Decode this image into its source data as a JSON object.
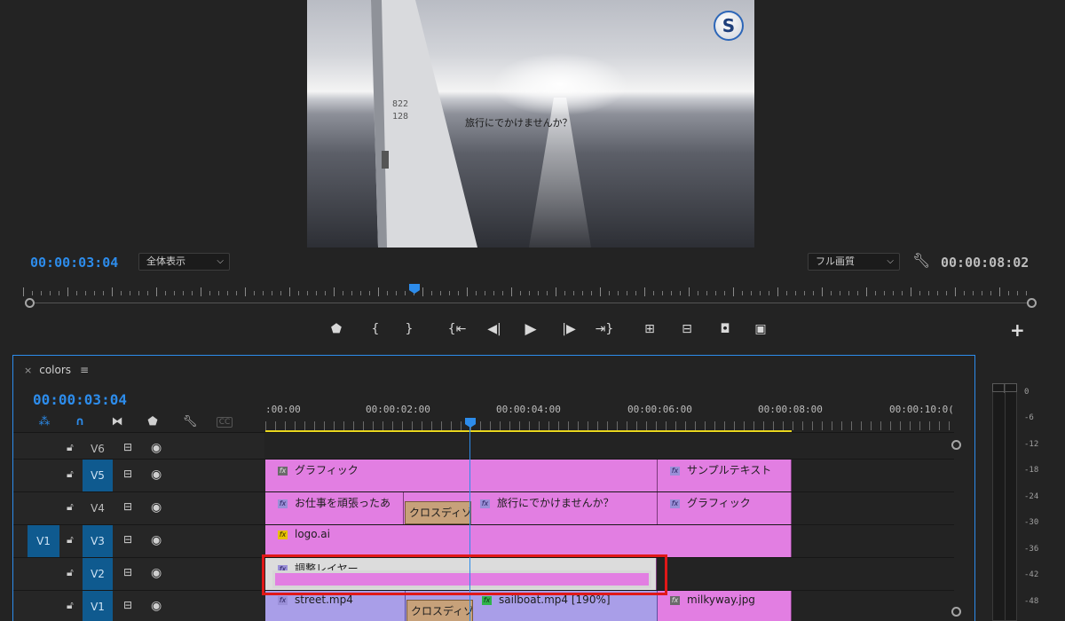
{
  "program": {
    "caption": "旅行にでかけませんか？",
    "logo_letter": "S",
    "sail_number_1": "822",
    "sail_number_2": "128",
    "timecode_current": "00:00:03:04",
    "zoom_label": "全体表示",
    "quality_label": "フル画質",
    "timecode_duration": "00:00:08:02"
  },
  "transport": {
    "marker_icon": "marker-icon",
    "mark_in_icon": "mark-in-icon",
    "mark_out_icon": "mark-out-icon",
    "goto_in_icon": "go-to-in-icon",
    "step_back_icon": "step-back-icon",
    "play_icon": "play-icon",
    "step_forward_icon": "step-forward-icon",
    "goto_out_icon": "go-to-out-icon",
    "lift_icon": "lift-icon",
    "extract_icon": "extract-icon",
    "export_frame_icon": "camera-icon",
    "compare_icon": "compare-icon",
    "plus": "+"
  },
  "timeline": {
    "close": "×",
    "sequence_name": "colors",
    "menu": "≡",
    "timecode": "00:00:03:04",
    "cc_label": "CC",
    "ruler_labels": [
      ":00:00",
      "00:00:02:00",
      "00:00:04:00",
      "00:00:06:00",
      "00:00:08:00",
      "00:00:10:0("
    ],
    "tracks": [
      {
        "name": "V6",
        "source": "",
        "clips": []
      },
      {
        "name": "V5",
        "source": "",
        "clips": [
          {
            "label": "グラフィック",
            "fx": "gray"
          },
          {
            "label": "サンプルテキスト",
            "fx": "purple"
          }
        ]
      },
      {
        "name": "V4",
        "source": "",
        "clips": [
          {
            "label": "お仕事を頑張ったあ",
            "fx": "purple"
          },
          {
            "label": "旅行にでかけませんか？",
            "fx": "purple"
          },
          {
            "label": "グラフィック",
            "fx": "purple"
          }
        ],
        "transition": "クロスディゾ"
      },
      {
        "name": "V3",
        "source": "V1",
        "clips": [
          {
            "label": "logo.ai",
            "fx": "yellow"
          }
        ]
      },
      {
        "name": "V2",
        "source": "",
        "clips": [
          {
            "label": "調整レイヤー",
            "fx": "purple"
          }
        ]
      },
      {
        "name": "V1",
        "source": "",
        "clips": [
          {
            "label": "street.mp4",
            "fx": "purple"
          },
          {
            "label": "sailboat.mp4 [190%]",
            "fx": "green"
          },
          {
            "label": "milkyway.jpg",
            "fx": "gray"
          }
        ],
        "transition": "クロスディゾ"
      }
    ]
  },
  "meter": {
    "db_labels": [
      "0",
      "-6",
      "-12",
      "-18",
      "-24",
      "-30",
      "-36",
      "-42",
      "-48"
    ]
  },
  "colors": {
    "accent_blue": "#2d8ceb",
    "clip_pink": "#e27ee2",
    "clip_violet": "#a99ee8",
    "work_area_yellow": "#e8d61e",
    "highlight_red": "#e01818"
  }
}
